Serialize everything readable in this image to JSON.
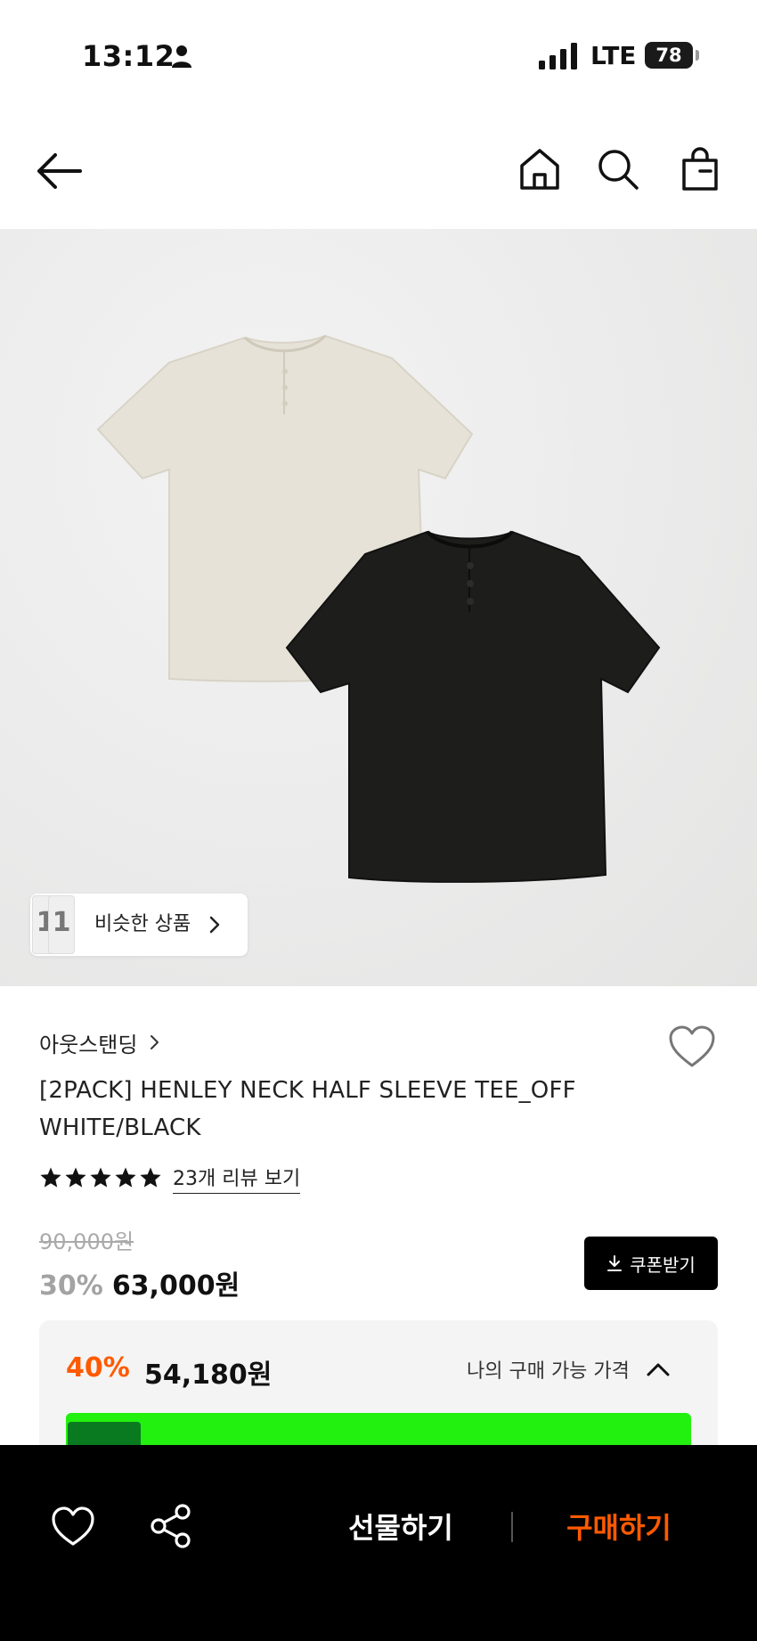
{
  "status_bar": {
    "time": "13:12",
    "network": "LTE",
    "battery": "78"
  },
  "header": {
    "back_icon": "back-arrow-icon",
    "home_icon": "home-icon",
    "search_icon": "search-icon",
    "cart_icon": "shopping-bag-icon"
  },
  "image": {
    "similar_label": "비슷한 상품",
    "thumb_1": "1",
    "thumb_2": "1"
  },
  "product": {
    "brand": "아웃스탠딩",
    "title": "[2PACK] HENLEY NECK HALF SLEEVE TEE_OFF WHITE/BLACK",
    "rating_stars": 5,
    "review_label": "23개 리뷰 보기",
    "original_price": "90,000원",
    "discount_rate": "30%",
    "sale_price": "63,000원",
    "coupon_label": "쿠폰받기"
  },
  "benefit": {
    "rate": "40%",
    "price": "54,180원",
    "toggle_label": "나의 구매 가능 가격"
  },
  "bottom_bar": {
    "gift_label": "선물하기",
    "buy_label": "구매하기"
  },
  "colors": {
    "accent_orange": "#ff5a00",
    "promo_green": "#22f00e",
    "bottom_bar_bg": "#000000"
  }
}
